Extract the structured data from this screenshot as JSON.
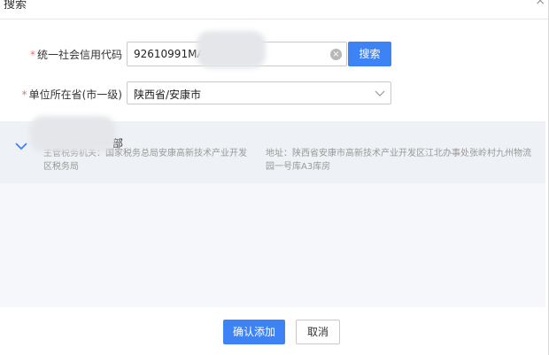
{
  "dialog": {
    "title": "搜索",
    "close_glyph": "×"
  },
  "form": {
    "required_mark": "*",
    "credit_code": {
      "label": "统一社会信用代码",
      "value": "92610991MA",
      "clear_icon": "clear-circle-icon"
    },
    "search_button_label": "搜索",
    "region": {
      "label": "单位所在省(市一级)",
      "selected": "陕西省/安康市",
      "chevron_icon": "chevron-down-icon"
    }
  },
  "results": [
    {
      "name_visible": "部",
      "tax_authority": "主管税务机关：国家税务总局安康高新技术产业开发区税务局",
      "address": "地址：陕西省安康市高新技术产业开发区江北办事处张岭村九州物流园一号库A3库房",
      "expand_icon": "chevron-down-icon"
    }
  ],
  "footer": {
    "confirm_label": "确认添加",
    "cancel_label": "取消"
  },
  "colors": {
    "primary": "#3d83f5",
    "required": "#f56c6c",
    "muted_text": "#999999"
  }
}
